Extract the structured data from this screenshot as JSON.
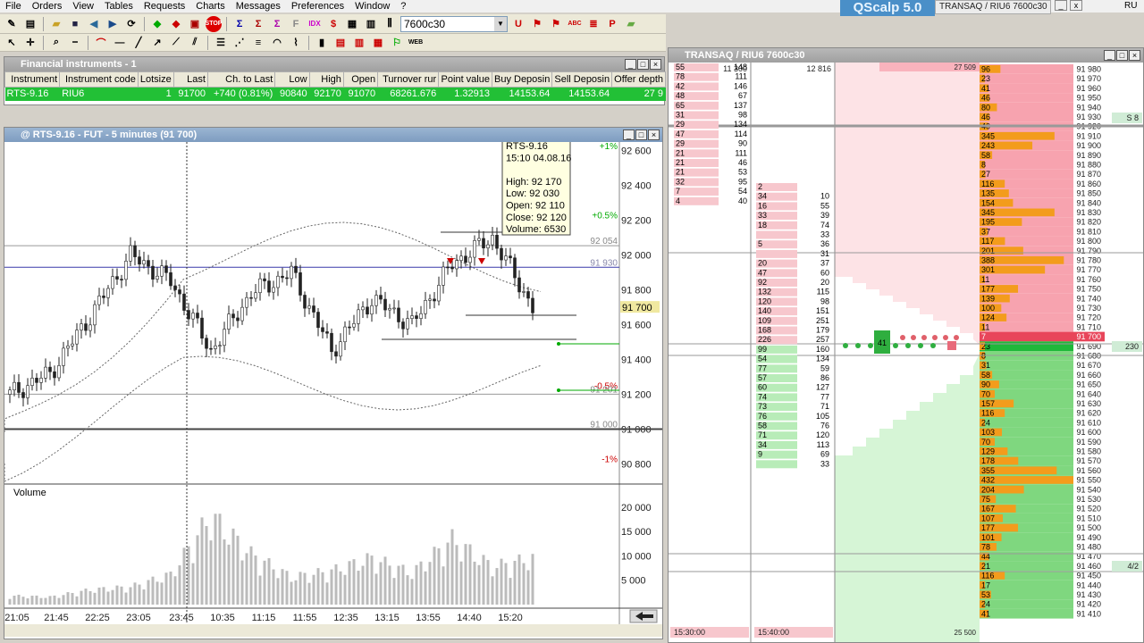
{
  "menu": [
    "File",
    "Orders",
    "View",
    "Tables",
    "Requests",
    "Charts",
    "Messages",
    "Preferences",
    "Window",
    "?"
  ],
  "app_badge": "QScalp 5.0",
  "top_window_tab": "TRANSAQ / RIU6 7600c30",
  "lang": "RU",
  "toolbar": {
    "instrument_combo": "7600c30"
  },
  "fin_window": {
    "title": "Financial instruments - 1",
    "columns": [
      "Instrument",
      "Instrument code",
      "Lotsize",
      "Last",
      "Ch. to Last",
      "Low",
      "High",
      "Open",
      "Turnover rur",
      "Point value",
      "Buy Deposin",
      "Sell Deposin",
      "Offer depth"
    ],
    "row": [
      "RTS-9.16",
      "RIU6",
      "1",
      "91700",
      "+740 (0.81%)",
      "90840",
      "92170",
      "91070",
      "68261.676",
      "1.32913",
      "14153.64",
      "14153.64",
      "27 9"
    ]
  },
  "chart_window": {
    "title": "@ RTS-9.16 - FUT - 5 minutes (91 700)",
    "volume_label": "Volume",
    "tooltip": [
      "RTS-9.16",
      "15:10 04.08.16",
      "",
      "High: 92 170",
      "Low: 92 030",
      "Open: 92 110",
      "Close: 92 120",
      "Volume: 6530"
    ],
    "price_ticks": [
      "92 600",
      "92 400",
      "92 200",
      "92 000",
      "91 800",
      "91 600",
      "91 400",
      "91 200",
      "91 000",
      "90 800"
    ],
    "volume_ticks": [
      "20 000",
      "15 000",
      "10 000",
      "5 000"
    ],
    "time_ticks": [
      "21:05",
      "21:45",
      "22:25",
      "23:05",
      "23:45",
      "10:35",
      "11:15",
      "11:55",
      "12:35",
      "13:15",
      "13:55",
      "14:40",
      "15:20"
    ],
    "level_labels": [
      "+1%",
      "+0.5%",
      "92 054",
      "91 930",
      "-0.5%",
      "91 201",
      "91 000",
      "-1%"
    ],
    "last_price": "91 700"
  },
  "chart_data": {
    "type": "candlestick",
    "title": "@ RTS-9.16 - FUT - 5 minutes (91 700)",
    "ylim": [
      90700,
      92650
    ],
    "x": [
      "21:05",
      "21:45",
      "22:25",
      "23:05",
      "23:45",
      "10:35",
      "11:15",
      "11:55",
      "12:35",
      "13:15",
      "13:55",
      "14:40",
      "15:20"
    ],
    "close": [
      91200,
      91320,
      91650,
      92000,
      91850,
      91450,
      91780,
      91900,
      91450,
      91750,
      91600,
      91950,
      92100,
      91700
    ],
    "volume_ylim": [
      0,
      22000
    ],
    "volume": [
      2100,
      1800,
      3500,
      4200,
      7100,
      21000,
      12000,
      6500,
      8000,
      11000,
      7500,
      15500,
      9000,
      11000
    ]
  },
  "dom_window": {
    "title": "TRANSAQ / RIU6 7600c30",
    "left_header": [
      "11 300",
      "12 816"
    ],
    "top_right_value": "27 509",
    "bottom_values": [
      "15:30:00",
      "15:40:00",
      "25 500"
    ],
    "side_badges": [
      "S 8",
      "230",
      "4/2"
    ],
    "ask_prices": [
      "91 980",
      "91 970",
      "91 960",
      "91 950",
      "91 940",
      "91 930",
      "91 920",
      "91 910",
      "91 900",
      "91 890",
      "91 880",
      "91 870",
      "91 860",
      "91 850",
      "91 840",
      "91 830",
      "91 820",
      "91 810",
      "91 800",
      "91 790",
      "91 780",
      "91 770",
      "91 760",
      "91 750",
      "91 740",
      "91 730",
      "91 720",
      "91 710"
    ],
    "ask_vols": [
      "96",
      "23",
      "41",
      "46",
      "80",
      "46",
      "40",
      "345",
      "243",
      "58",
      "8",
      "27",
      "116",
      "135",
      "154",
      "345",
      "195",
      "37",
      "117",
      "201",
      "388",
      "301",
      "11",
      "177",
      "139",
      "100",
      "124",
      "11"
    ],
    "best_price": "91 700",
    "best_vol": "7",
    "bid_prices": [
      "91 690",
      "91 680",
      "91 670",
      "91 660",
      "91 650",
      "91 640",
      "91 630",
      "91 620",
      "91 610",
      "91 600",
      "91 590",
      "91 580",
      "91 570",
      "91 560",
      "91 550",
      "91 540",
      "91 530",
      "91 520",
      "91 510",
      "91 500",
      "91 490",
      "91 480",
      "91 470",
      "91 460",
      "91 450",
      "91 440",
      "91 430",
      "91 420",
      "91 410"
    ],
    "bid_vols": [
      "23",
      "8",
      "31",
      "58",
      "90",
      "70",
      "157",
      "116",
      "24",
      "103",
      "70",
      "129",
      "178",
      "355",
      "432",
      "204",
      "75",
      "167",
      "107",
      "177",
      "101",
      "78",
      "44",
      "21",
      "116",
      "17",
      "53",
      "24",
      "41"
    ],
    "trades_left": [
      [
        "55",
        "148"
      ],
      [
        "78",
        "111"
      ],
      [
        "42",
        "146"
      ],
      [
        "48",
        "67"
      ],
      [
        "65",
        "137"
      ],
      [
        "31",
        "98"
      ],
      [
        "29",
        "134"
      ],
      [
        "47",
        "114"
      ],
      [
        "29",
        "90"
      ],
      [
        "21",
        "111"
      ],
      [
        "21",
        "46"
      ],
      [
        "21",
        "53"
      ],
      [
        "32",
        "95"
      ],
      [
        "7",
        "54"
      ],
      [
        "4",
        "40"
      ]
    ],
    "trades_right": [
      [
        "2",
        ""
      ],
      [
        "34",
        "10"
      ],
      [
        "16",
        "55"
      ],
      [
        "33",
        "39"
      ],
      [
        "18",
        "74"
      ],
      [
        "",
        "33"
      ],
      [
        "5",
        "36"
      ],
      [
        "",
        "31"
      ],
      [
        "20",
        "37"
      ],
      [
        "47",
        "60"
      ],
      [
        "92",
        "20"
      ],
      [
        "132",
        "115"
      ],
      [
        "120",
        "98"
      ],
      [
        "140",
        "151"
      ],
      [
        "109",
        "251"
      ],
      [
        "168",
        "179"
      ],
      [
        "226",
        "257"
      ],
      [
        "99",
        "160"
      ],
      [
        "54",
        "134"
      ],
      [
        "77",
        "59"
      ],
      [
        "57",
        "86"
      ],
      [
        "60",
        "127"
      ],
      [
        "74",
        "77"
      ],
      [
        "73",
        "71"
      ],
      [
        "76",
        "105"
      ],
      [
        "58",
        "76"
      ],
      [
        "71",
        "120"
      ],
      [
        "34",
        "113"
      ],
      [
        "9",
        "69"
      ],
      [
        "",
        "33"
      ]
    ],
    "cluster_value": "41"
  }
}
